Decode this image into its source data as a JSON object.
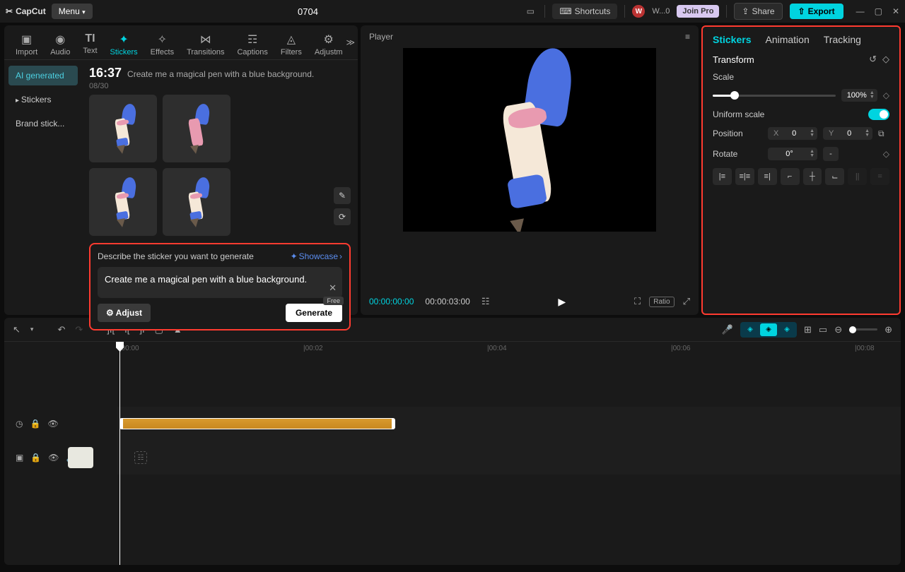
{
  "topbar": {
    "brand": "CapCut",
    "menu": "Menu",
    "project": "0704",
    "shortcuts": "Shortcuts",
    "user": "W...0",
    "joinpro": "Join Pro",
    "share": "Share",
    "export": "Export"
  },
  "toolTabs": {
    "import": "Import",
    "audio": "Audio",
    "text": "Text",
    "stickers": "Stickers",
    "effects": "Effects",
    "transitions": "Transitions",
    "captions": "Captions",
    "filters": "Filters",
    "adjustm": "Adjustm"
  },
  "sideNav": {
    "ai": "AI generated",
    "stickers": "Stickers",
    "brand": "Brand stick..."
  },
  "gen": {
    "time": "16:37",
    "desc": "Create me a magical pen with a blue background.",
    "count": "08/30"
  },
  "prompt": {
    "label": "Describe the sticker you want to generate",
    "showcase": "Showcase",
    "value": "Create me a magical pen with a blue background.",
    "adjust": "Adjust",
    "generate": "Generate",
    "free": "Free"
  },
  "player": {
    "title": "Player",
    "time1": "00:00:00:00",
    "time2": "00:00:03:00",
    "ratio": "Ratio"
  },
  "rp": {
    "tab1": "Stickers",
    "tab2": "Animation",
    "tab3": "Tracking",
    "transform": "Transform",
    "scale": "Scale",
    "scaleVal": "100%",
    "uniform": "Uniform scale",
    "position": "Position",
    "posX": "X",
    "posXv": "0",
    "posY": "Y",
    "posYv": "0",
    "rotate": "Rotate",
    "rotateVal": "0°",
    "mirror": "-"
  },
  "ruler": {
    "t0": "|00:00",
    "t2": "|00:02",
    "t4": "|00:04",
    "t6": "|00:06",
    "t8": "|00:08"
  }
}
